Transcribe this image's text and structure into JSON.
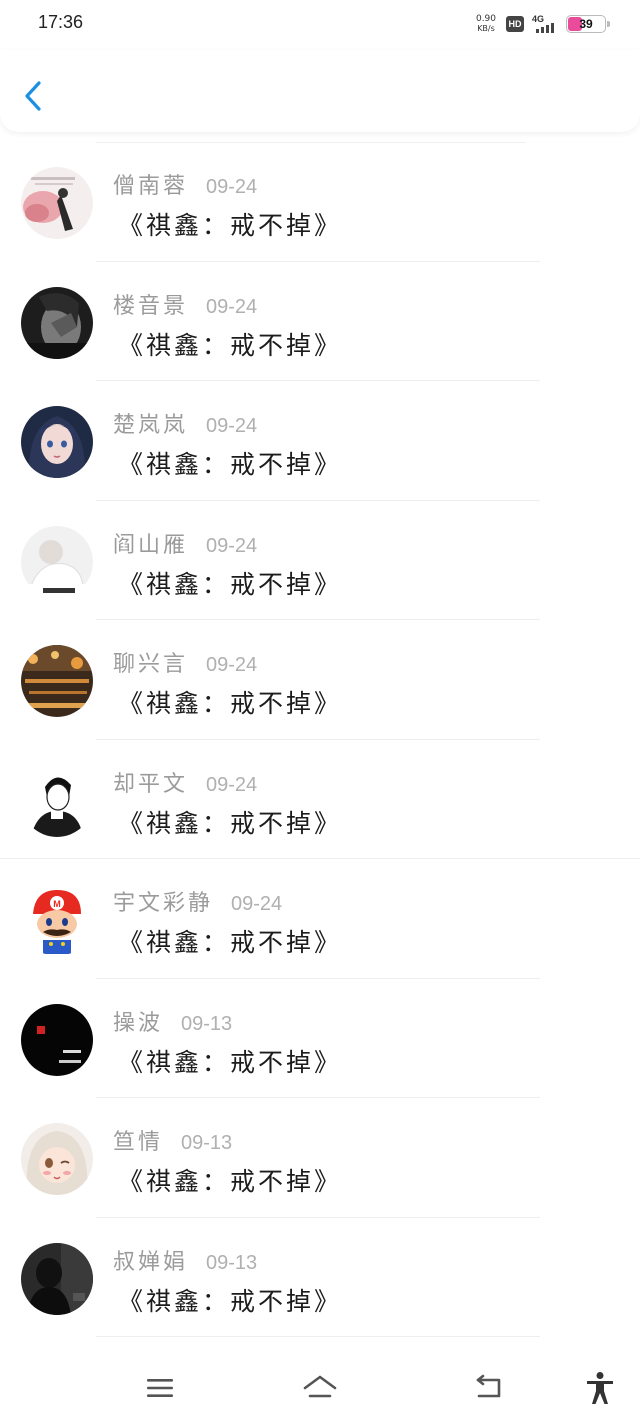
{
  "status_bar": {
    "time": "17:36",
    "net_speed_value": "0.90",
    "net_speed_unit": "KB/s",
    "hd": "HD",
    "network": "4G",
    "battery": "39"
  },
  "header": {
    "back_icon": "chevron-left-icon",
    "accent_color": "#1a8fe3"
  },
  "comments": [
    {
      "author": "僧南蓉",
      "date": "09-24",
      "title": "《祺鑫：戒不掉》",
      "avatar": "pink-illustration-avatar"
    },
    {
      "author": "楼音景",
      "date": "09-24",
      "title": "《祺鑫：戒不掉》",
      "avatar": "monochrome-portrait-avatar"
    },
    {
      "author": "楚岚岚",
      "date": "09-24",
      "title": "《祺鑫：戒不掉》",
      "avatar": "anime-girl-avatar"
    },
    {
      "author": "阎山雁",
      "date": "09-24",
      "title": "《祺鑫：戒不掉》",
      "avatar": "white-figure-avatar"
    },
    {
      "author": "聊兴言",
      "date": "09-24",
      "title": "《祺鑫：戒不掉》",
      "avatar": "city-lights-avatar"
    },
    {
      "author": "却平文",
      "date": "09-24",
      "title": "《祺鑫：戒不掉》",
      "avatar": "sketch-boy-avatar"
    },
    {
      "author": "宇文彩静",
      "date": "09-24",
      "title": "《祺鑫：戒不掉》",
      "avatar": "mario-avatar"
    },
    {
      "author": "操波",
      "date": "09-13",
      "title": "《祺鑫：戒不掉》",
      "avatar": "black-text-avatar"
    },
    {
      "author": "笪情",
      "date": "09-13",
      "title": "《祺鑫：戒不掉》",
      "avatar": "winking-anime-avatar"
    },
    {
      "author": "叔婵娟",
      "date": "09-13",
      "title": "《祺鑫：戒不掉》",
      "avatar": "dark-silhouette-avatar"
    }
  ],
  "navbar": {
    "items": [
      "menu-icon",
      "home-icon",
      "back-arrow-icon",
      "accessibility-icon"
    ]
  }
}
